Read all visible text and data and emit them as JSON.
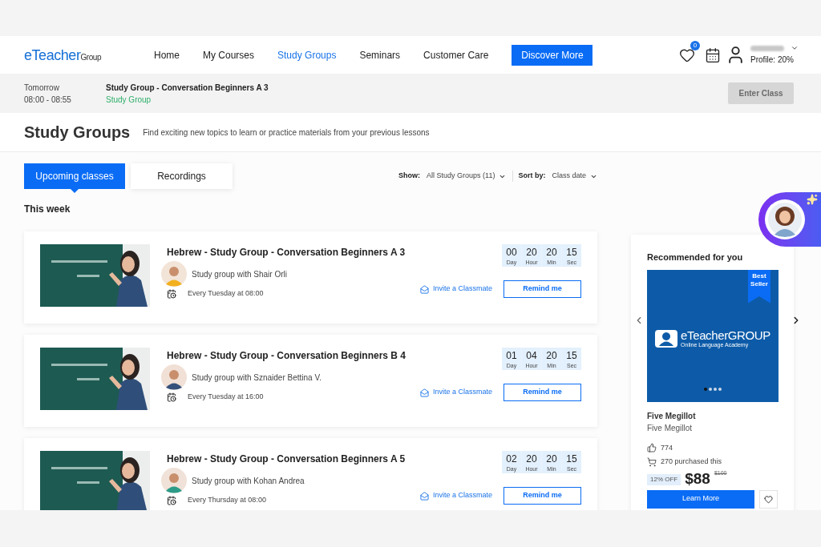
{
  "header": {
    "logo": {
      "main": "eTeacher",
      "suffix": "Group"
    },
    "nav": [
      {
        "label": "Home",
        "selected": false
      },
      {
        "label": "My Courses",
        "selected": false
      },
      {
        "label": "Study Groups",
        "selected": true
      },
      {
        "label": "Seminars",
        "selected": false
      },
      {
        "label": "Customer Care",
        "selected": false
      }
    ],
    "cta": "Discover More",
    "wishlist_count": "0",
    "profile": "Profile: 20%"
  },
  "next_class": {
    "day": "Tomorrow",
    "time": "08:00 - 08:55",
    "title": "Study Group - Conversation Beginners A 3",
    "type": "Study Group",
    "button": {
      "label": "Enter Class",
      "disabled": true
    }
  },
  "page": {
    "title": "Study Groups",
    "subtitle": "Find exciting new topics to learn or practice materials from your previous lessons"
  },
  "tabs": [
    {
      "label": "Upcoming classes",
      "selected": true
    },
    {
      "label": "Recordings",
      "selected": false
    }
  ],
  "filters": [
    {
      "label": "Show:",
      "value": "All Study Groups (11)"
    },
    {
      "label": "Sort by:",
      "value": "Class date"
    }
  ],
  "section_title": "This week",
  "classes": [
    {
      "title": "Hebrew - Study Group - Conversation Beginners A 3",
      "teacher": "Study group with Shair Orli",
      "schedule": "Every Tuesday at 08:00",
      "countdown": [
        {
          "value": "00",
          "unit": "Day"
        },
        {
          "value": "20",
          "unit": "Hour"
        },
        {
          "value": "20",
          "unit": "Min"
        },
        {
          "value": "15",
          "unit": "Sec"
        }
      ],
      "invite": "Invite a Classmate",
      "remind": "Remind me"
    },
    {
      "title": "Hebrew - Study Group - Conversation Beginners B 4",
      "teacher": "Study group with Sznaider Bettina V.",
      "schedule": "Every Tuesday at 16:00",
      "countdown": [
        {
          "value": "01",
          "unit": "Day"
        },
        {
          "value": "04",
          "unit": "Hour"
        },
        {
          "value": "20",
          "unit": "Min"
        },
        {
          "value": "15",
          "unit": "Sec"
        }
      ],
      "invite": "Invite a Classmate",
      "remind": "Remind me"
    },
    {
      "title": "Hebrew - Study Group - Conversation Beginners A 5",
      "teacher": "Study group with Kohan Andrea",
      "schedule": "Every Thursday at 08:00",
      "countdown": [
        {
          "value": "02",
          "unit": "Day"
        },
        {
          "value": "20",
          "unit": "Hour"
        },
        {
          "value": "20",
          "unit": "Min"
        },
        {
          "value": "15",
          "unit": "Sec"
        }
      ],
      "invite": "Invite a Classmate",
      "remind": "Remind me"
    }
  ],
  "recommended": {
    "heading": "Recommended for you",
    "badge": "Best Seller",
    "brand": "eTeacherGROUP",
    "brand_tagline": "Online Language Academy",
    "slides": [
      {
        "selected": true
      },
      {
        "selected": false
      },
      {
        "selected": false
      },
      {
        "selected": false
      }
    ],
    "title": "Five Megillot",
    "subtitle": "Five Megillot",
    "likes": "774",
    "purchases": "270 purchased this",
    "discount": "12% OFF",
    "price": "$88",
    "old_price": "$100",
    "button": "Learn More"
  }
}
